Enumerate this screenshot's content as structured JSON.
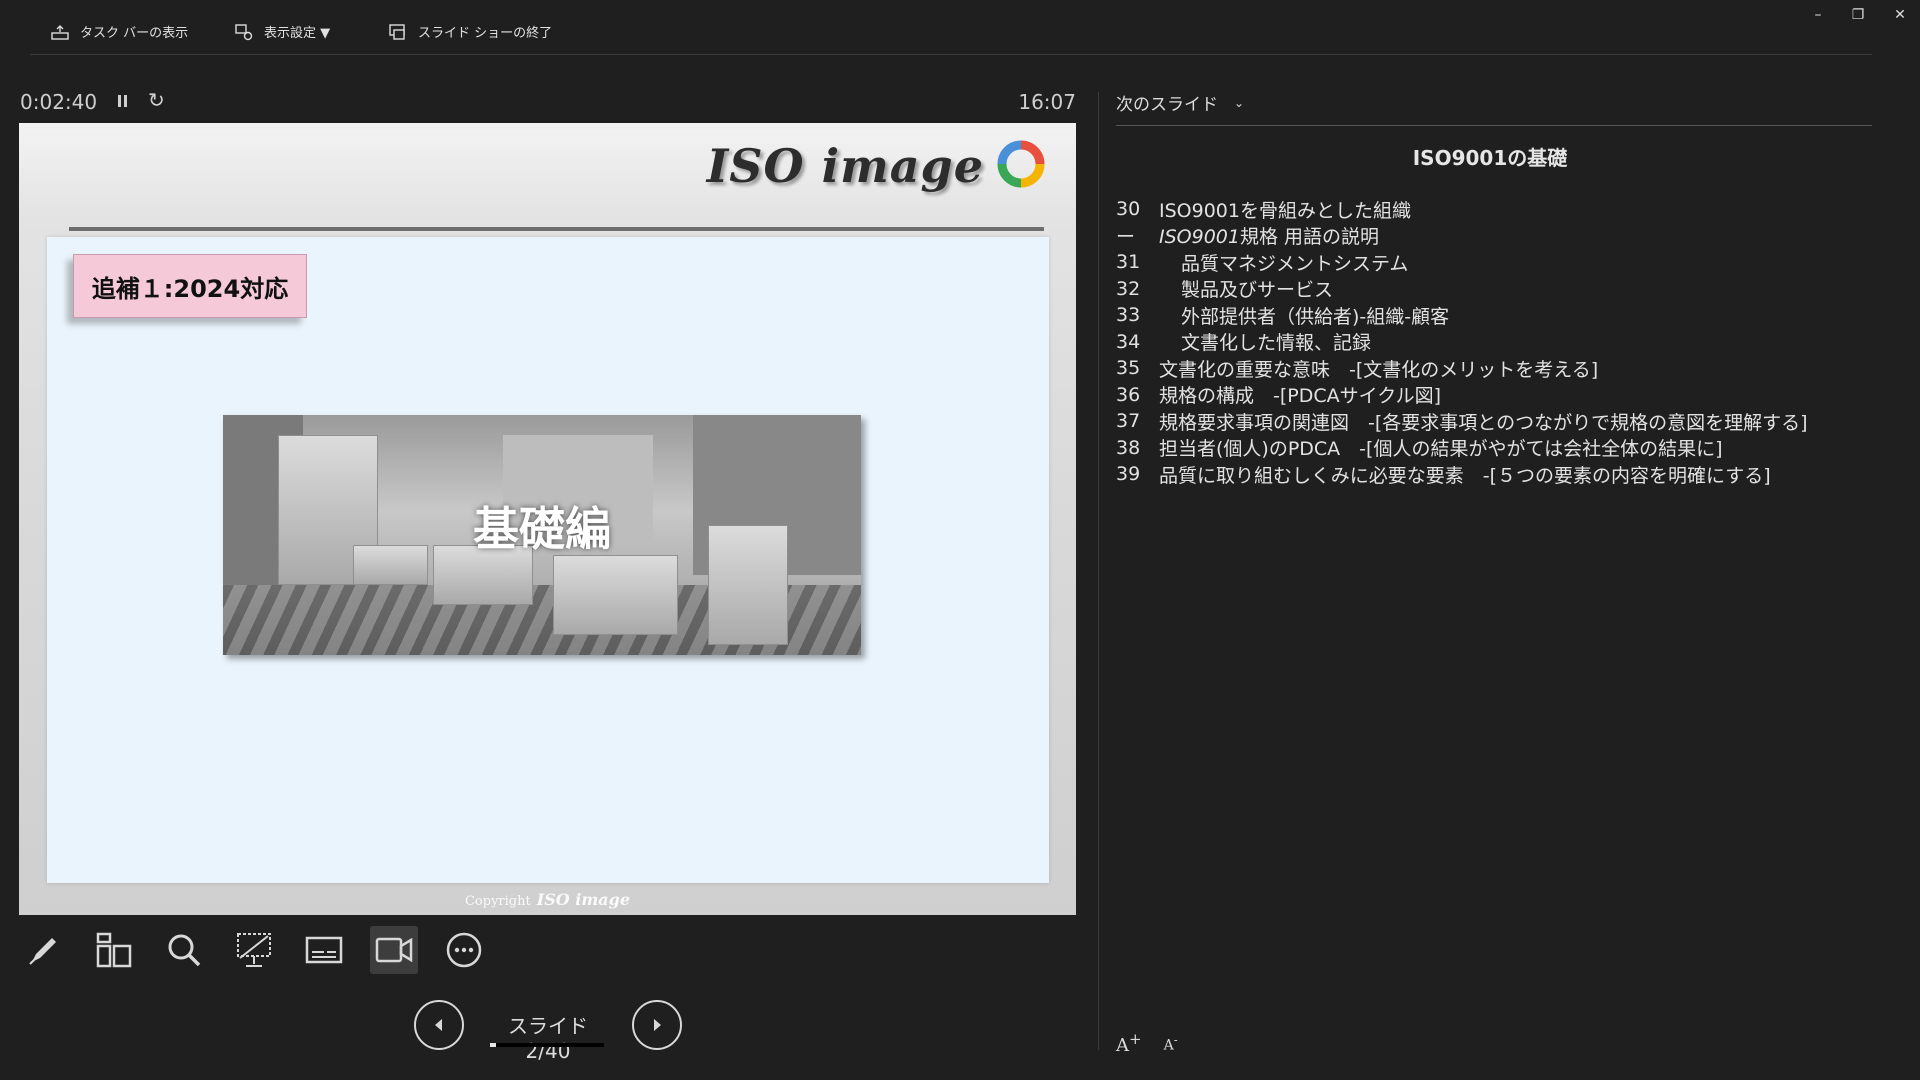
{
  "toolbar": {
    "taskbar_label": "タスク バーの表示",
    "display_settings_label": "表示設定 ▼",
    "end_show_label": "スライド ショーの終了"
  },
  "window": {
    "minimize": "–",
    "restore": "❐",
    "close": "✕"
  },
  "presenter": {
    "elapsed": "0:02:40",
    "clock": "16:07",
    "slide_label": "スライド 2/40",
    "progress": 0.05
  },
  "slide": {
    "logo_text": "ISO image",
    "tag_text": "追補１:2024対応",
    "photo_caption": "基礎編",
    "copyright_prefix": "Copyright",
    "copyright_logo": "ISO image"
  },
  "tools": [
    {
      "name": "pen-tool-icon"
    },
    {
      "name": "all-slides-icon"
    },
    {
      "name": "zoom-icon"
    },
    {
      "name": "black-screen-icon"
    },
    {
      "name": "subtitles-icon"
    },
    {
      "name": "camera-icon"
    },
    {
      "name": "more-options-icon"
    }
  ],
  "next_panel": {
    "header": "次のスライド",
    "title": "ISO9001の基礎",
    "notes": [
      {
        "num": "30",
        "text": "ISO9001を骨組みとした組織",
        "indent": false
      },
      {
        "num": "ー",
        "italic": "ISO9001",
        "text": "規格 用語の説明",
        "indent": false
      },
      {
        "num": "31",
        "text": "品質マネジメントシステム",
        "indent": true
      },
      {
        "num": "32",
        "text": "製品及びサービス",
        "indent": true
      },
      {
        "num": "33",
        "text": "外部提供者（供給者)-組織-顧客",
        "indent": true
      },
      {
        "num": "34",
        "text": "文書化した情報、記録",
        "indent": true
      },
      {
        "num": "35",
        "text": "文書化の重要な意味　-[文書化のメリットを考える]",
        "indent": false
      },
      {
        "num": "36",
        "text": "規格の構成　-[PDCAサイクル図]",
        "indent": false
      },
      {
        "num": "37",
        "text": "規格要求事項の関連図　-[各要求事項とのつながりで規格の意図を理解する]",
        "indent": false
      },
      {
        "num": "38",
        "text": "担当者(個人)のPDCA　-[個人の結果がやがては会社全体の結果に]",
        "indent": false
      },
      {
        "num": "39",
        "text": "品質に取り組むしくみに必要な要素　-[５つの要素の内容を明確にする]",
        "indent": false
      }
    ],
    "font_up": "A",
    "font_down": "A"
  }
}
